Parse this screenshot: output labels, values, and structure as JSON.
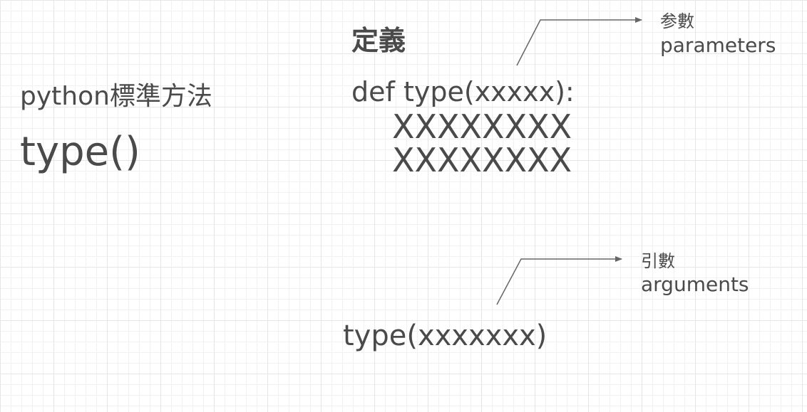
{
  "left": {
    "subtitle": "python標準方法",
    "title": "type()"
  },
  "definition": {
    "heading": "定義",
    "signature": "def type(xxxxx):",
    "body_lines": [
      "XXXXXXXX",
      "XXXXXXXX"
    ]
  },
  "parameters_callout": {
    "label_cjk": "参數",
    "label_en": "parameters"
  },
  "arguments_callout": {
    "label_cjk": "引數",
    "label_en": "arguments"
  },
  "call": {
    "text": "type(xxxxxxx)"
  },
  "colors": {
    "text": "#4a4a4a",
    "arrow": "#666666",
    "grid_major": "#e6e6e6",
    "grid_minor": "#f1f1f1"
  }
}
